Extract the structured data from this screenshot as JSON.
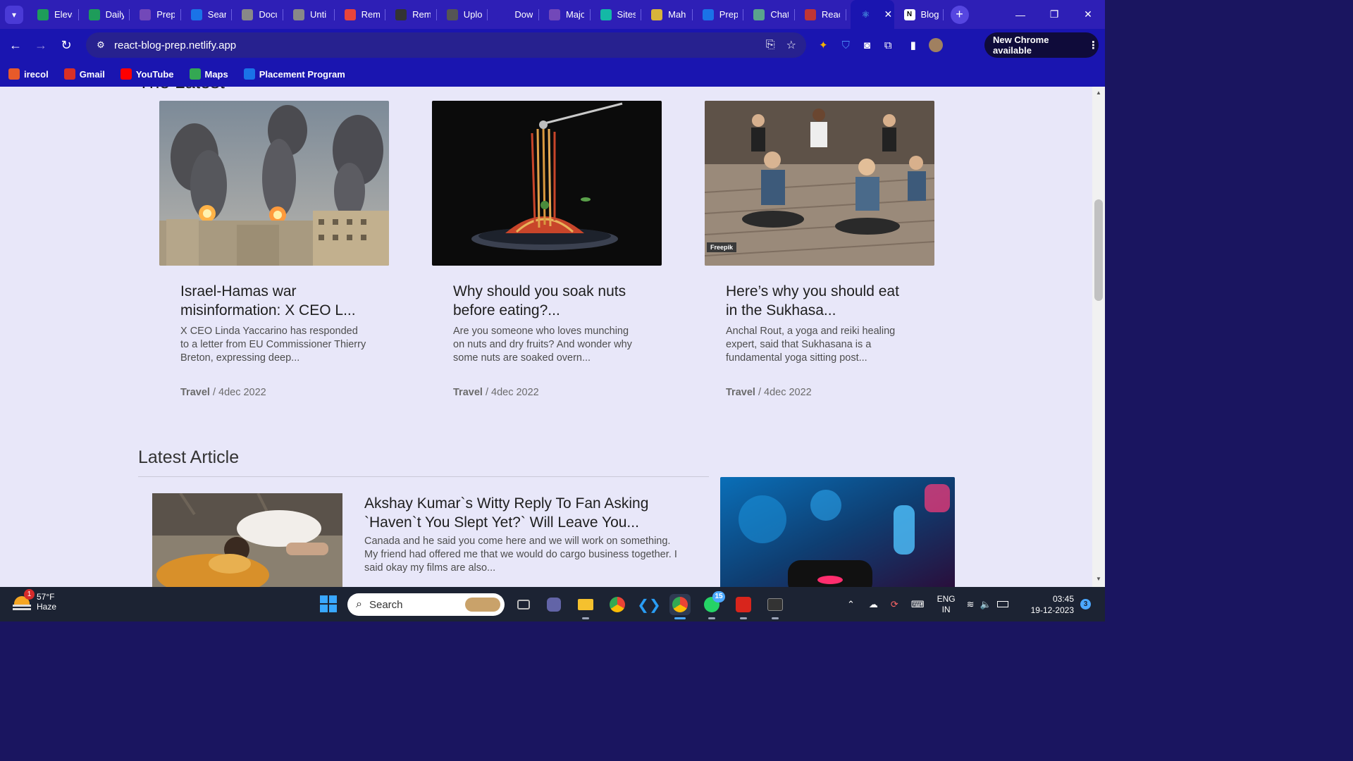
{
  "browser": {
    "tabs": [
      {
        "label": "Eleva",
        "icon": "sheets-icon",
        "color": "#1e9c5a"
      },
      {
        "label": "Daily",
        "icon": "sheets-icon",
        "color": "#1e9c5a"
      },
      {
        "label": "Prep",
        "icon": "forms-icon",
        "color": "#7248b9"
      },
      {
        "label": "Sear",
        "icon": "vuetify-icon",
        "color": "#1a73e8"
      },
      {
        "label": "Docu",
        "icon": "globe-icon",
        "color": "#888888"
      },
      {
        "label": "Unti",
        "icon": "globe-icon",
        "color": "#888888"
      },
      {
        "label": "Rem",
        "icon": "bookmark-icon",
        "color": "#e8443a"
      },
      {
        "label": "Rem",
        "icon": "github-icon",
        "color": "#333333"
      },
      {
        "label": "Uplo",
        "icon": "stack-icon",
        "color": "#555555"
      },
      {
        "label": "Dow",
        "icon": "download-icon",
        "color": "#2e1fb6"
      },
      {
        "label": "Majo",
        "icon": "forms-icon",
        "color": "#7248b9"
      },
      {
        "label": "Sites",
        "icon": "diamond-icon",
        "color": "#14b8a6"
      },
      {
        "label": "Mah",
        "icon": "smile-icon",
        "color": "#d7b43a"
      },
      {
        "label": "Prep",
        "icon": "pb-icon",
        "color": "#1a73e8"
      },
      {
        "label": "Chat",
        "icon": "chatgpt-icon",
        "color": "#5aa38d"
      },
      {
        "label": "Reac",
        "icon": "fm-icon",
        "color": "#c03535"
      }
    ],
    "active_tab": {
      "label": "",
      "icon": "react-icon"
    },
    "blog_tab": {
      "label": "Blog",
      "icon": "notion-icon"
    },
    "url": "react-blog-prep.netlify.app",
    "new_chrome": "New Chrome available",
    "bookmarks": [
      {
        "label": "irecol",
        "icon": "irecol-icon",
        "color": "#e85a2a"
      },
      {
        "label": "Gmail",
        "icon": "gmail-icon",
        "color": "#d93025"
      },
      {
        "label": "YouTube",
        "icon": "youtube-icon",
        "color": "#ff0000"
      },
      {
        "label": "Maps",
        "icon": "maps-icon",
        "color": "#34a853"
      },
      {
        "label": "Placement Program",
        "icon": "pb-icon",
        "color": "#1a73e8"
      }
    ]
  },
  "page": {
    "top_section_title": "The Latest",
    "cards": [
      {
        "title": "Israel-Hamas war misinformation: X CEO L...",
        "excerpt": "X CEO Linda Yaccarino has responded to a letter from EU Commissioner Thierry Breton, expressing deep...",
        "category": "Travel",
        "date": " / 4dec 2022",
        "image": "war-smoke-image"
      },
      {
        "title": "Why should you soak nuts before eating?...",
        "excerpt": "Are you someone who loves munching on nuts and dry fruits? And wonder why some nuts are soaked overn...",
        "category": "Travel",
        "date": " / 4dec 2022",
        "image": "spaghetti-image"
      },
      {
        "title": "Here’s why you should eat in the Sukhasa...",
        "excerpt": "Anchal Rout, a yoga and reiki healing expert, said that Sukhasana is a fundamental yoga sitting post...",
        "category": "Travel",
        "date": " / 4dec 2022",
        "image": "yoga-image",
        "image_credit": "Freepik"
      }
    ],
    "latest_article": {
      "section_title": "Latest Article",
      "title": "Akshay Kumar`s Witty Reply To Fan Asking `Haven`t You Slept Yet?` Will Leave You...",
      "excerpt": "Canada and he said you come here and we will work on something. My friend had offered me that we would do cargo business together. I said okay my films are also..."
    }
  },
  "taskbar": {
    "weather": {
      "temp": "57°F",
      "condition": "Haze",
      "badge": "1"
    },
    "search_placeholder": "Search",
    "whatsapp_badge": "15",
    "lang_top": "ENG",
    "lang_bottom": "IN",
    "time": "03:45",
    "date": "19-12-2023",
    "notifications": "3"
  }
}
